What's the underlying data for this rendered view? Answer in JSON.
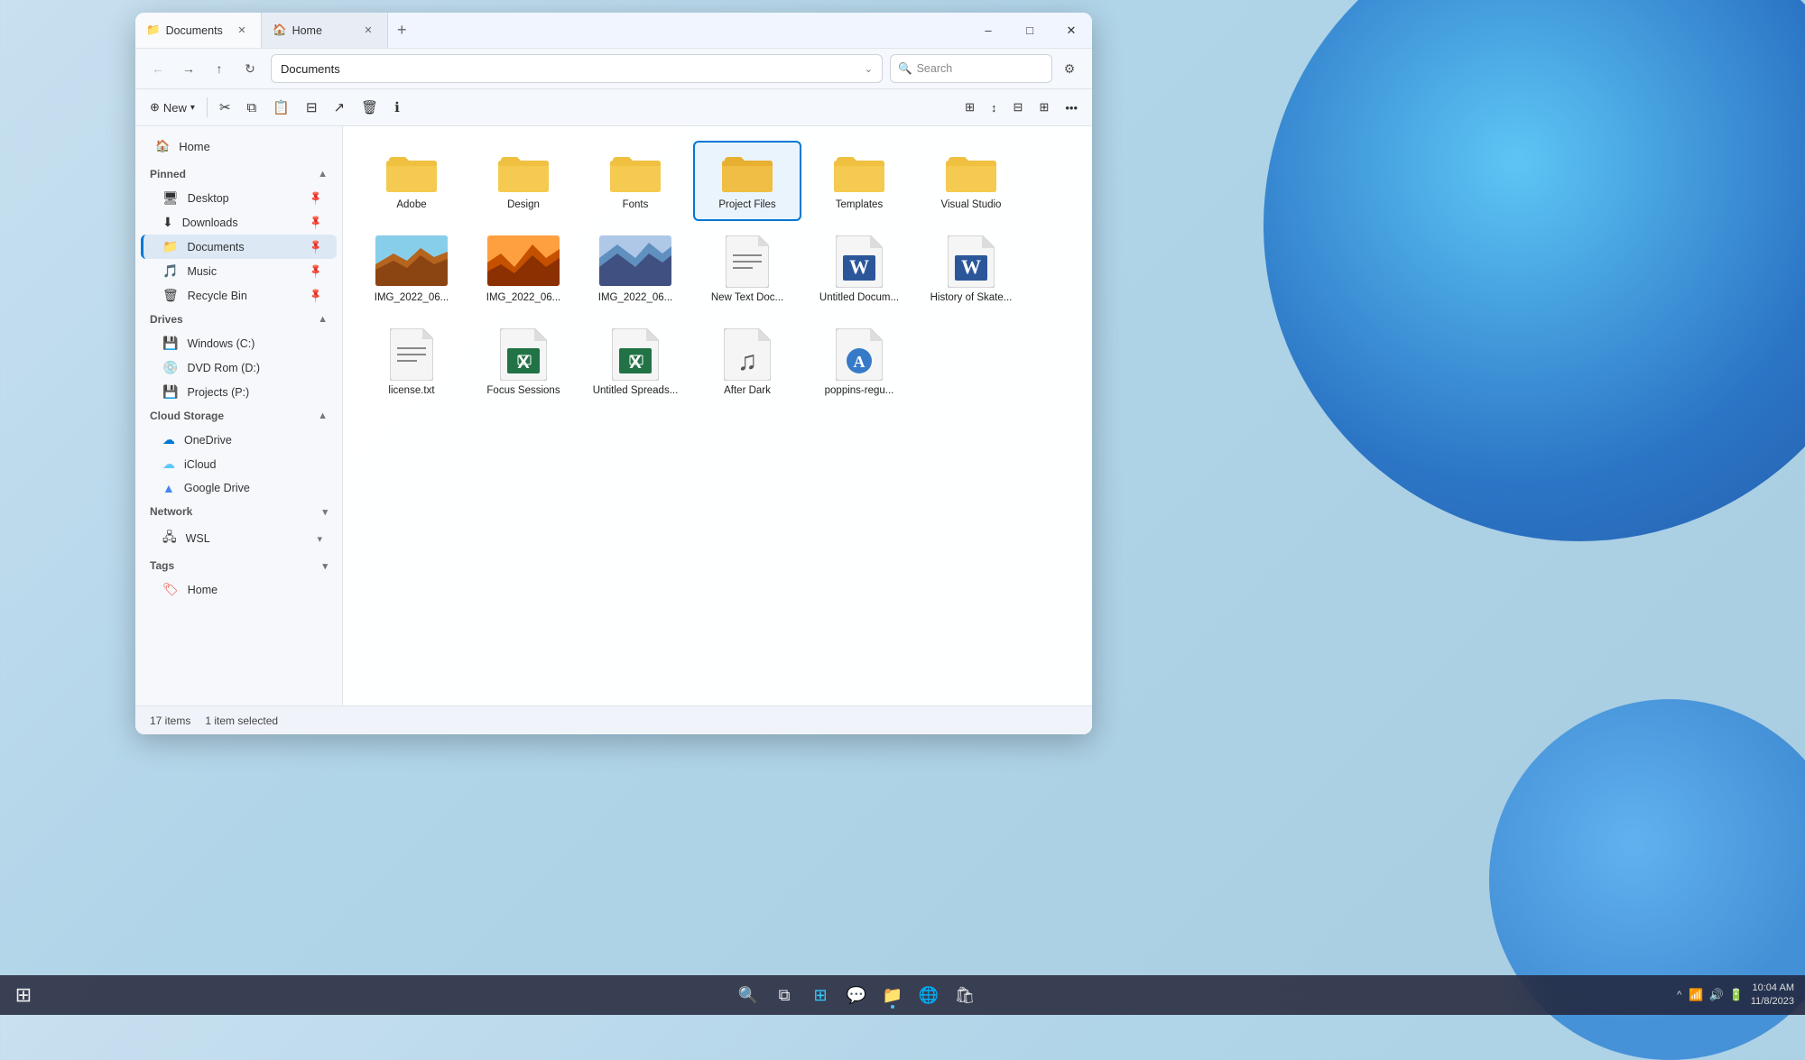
{
  "window": {
    "title": "Documents",
    "tabs": [
      {
        "label": "Documents",
        "icon": "📁",
        "active": true
      },
      {
        "label": "Home",
        "icon": "🏠",
        "active": false
      }
    ],
    "address": "Documents",
    "search_placeholder": "Search"
  },
  "toolbar": {
    "new_label": "New",
    "buttons": [
      {
        "id": "cut",
        "icon": "✂",
        "label": ""
      },
      {
        "id": "copy",
        "icon": "⧉",
        "label": ""
      },
      {
        "id": "paste",
        "icon": "📋",
        "label": ""
      },
      {
        "id": "rename",
        "icon": "✏",
        "label": ""
      },
      {
        "id": "share",
        "icon": "↗",
        "label": ""
      },
      {
        "id": "delete",
        "icon": "🗑",
        "label": ""
      },
      {
        "id": "info",
        "icon": "ℹ",
        "label": ""
      }
    ],
    "right_buttons": [
      {
        "id": "sort",
        "icon": "⊞"
      },
      {
        "id": "order",
        "icon": "↕"
      },
      {
        "id": "view1",
        "icon": "⊟"
      },
      {
        "id": "view2",
        "icon": "⊞"
      },
      {
        "id": "more",
        "icon": "…"
      }
    ]
  },
  "sidebar": {
    "home_label": "Home",
    "sections": [
      {
        "id": "pinned",
        "label": "Pinned",
        "expanded": true,
        "items": [
          {
            "id": "desktop",
            "label": "Desktop",
            "icon": "🖥",
            "pinned": true
          },
          {
            "id": "downloads",
            "label": "Downloads",
            "icon": "⬇",
            "pinned": true
          },
          {
            "id": "documents",
            "label": "Documents",
            "icon": "📁",
            "active": true,
            "pinned": true
          },
          {
            "id": "music",
            "label": "Music",
            "icon": "🎵",
            "pinned": true
          },
          {
            "id": "recycle",
            "label": "Recycle Bin",
            "icon": "🗑",
            "pinned": true
          }
        ]
      },
      {
        "id": "drives",
        "label": "Drives",
        "expanded": true,
        "items": [
          {
            "id": "windows-c",
            "label": "Windows (C:)",
            "icon": "💾"
          },
          {
            "id": "dvd-d",
            "label": "DVD Rom (D:)",
            "icon": "💿"
          },
          {
            "id": "projects-p",
            "label": "Projects (P:)",
            "icon": "💾"
          }
        ]
      },
      {
        "id": "cloud",
        "label": "Cloud Storage",
        "expanded": true,
        "items": [
          {
            "id": "onedrive",
            "label": "OneDrive",
            "icon": "☁"
          },
          {
            "id": "icloud",
            "label": "iCloud",
            "icon": "☁"
          },
          {
            "id": "gdrive",
            "label": "Google Drive",
            "icon": "△"
          }
        ]
      },
      {
        "id": "network",
        "label": "Network",
        "expanded": false,
        "items": [
          {
            "id": "wsl",
            "label": "WSL",
            "icon": "🖧"
          }
        ]
      },
      {
        "id": "tags",
        "label": "Tags",
        "expanded": false,
        "items": [
          {
            "id": "home-tag",
            "label": "Home",
            "icon": "🏷"
          }
        ]
      }
    ]
  },
  "files": {
    "folders": [
      {
        "id": "adobe",
        "name": "Adobe"
      },
      {
        "id": "design",
        "name": "Design"
      },
      {
        "id": "fonts",
        "name": "Fonts"
      },
      {
        "id": "project-files",
        "name": "Project Files",
        "selected": true
      },
      {
        "id": "templates",
        "name": "Templates"
      },
      {
        "id": "visual-studio",
        "name": "Visual Studio"
      }
    ],
    "files": [
      {
        "id": "img1",
        "name": "IMG_2022_06...",
        "type": "image",
        "color1": "#b5651d",
        "color2": "#8B4513"
      },
      {
        "id": "img2",
        "name": "IMG_2022_06...",
        "type": "image",
        "color1": "#d2691e",
        "color2": "#a0522d"
      },
      {
        "id": "img3",
        "name": "IMG_2022_06...",
        "type": "image",
        "color1": "#4682b4",
        "color2": "#708090"
      },
      {
        "id": "newtxt",
        "name": "New Text Doc...",
        "type": "text"
      },
      {
        "id": "untitled-doc",
        "name": "Untitled Docum...",
        "type": "word"
      },
      {
        "id": "history",
        "name": "History of Skate...",
        "type": "word"
      },
      {
        "id": "license",
        "name": "license.txt",
        "type": "text"
      },
      {
        "id": "focus",
        "name": "Focus Sessions",
        "type": "excel"
      },
      {
        "id": "spreadsheet",
        "name": "Untitled Spreads...",
        "type": "excel"
      },
      {
        "id": "afterdark",
        "name": "After Dark",
        "type": "audio"
      },
      {
        "id": "poppins",
        "name": "poppins-regu...",
        "type": "font"
      }
    ]
  },
  "status_bar": {
    "item_count": "17 items",
    "selected_info": "1 item selected"
  },
  "taskbar": {
    "time": "10:04 AM",
    "date": "11/8/2023",
    "icons": [
      {
        "id": "search",
        "icon": "⊕"
      },
      {
        "id": "task-view",
        "icon": "⧉"
      },
      {
        "id": "widgets",
        "icon": "⊞"
      },
      {
        "id": "chat",
        "icon": "💬"
      },
      {
        "id": "file-explorer",
        "icon": "📁",
        "active": true
      },
      {
        "id": "edge",
        "icon": "🌐"
      },
      {
        "id": "store",
        "icon": "🛍"
      }
    ]
  }
}
